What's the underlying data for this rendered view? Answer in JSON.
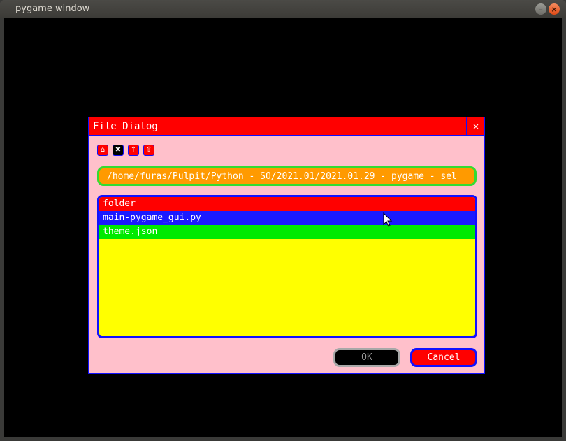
{
  "window": {
    "title": "pygame window",
    "minimize_icon": "minimize-icon",
    "close_icon": "close-icon"
  },
  "dialog": {
    "title": "File Dialog",
    "close_label": "×",
    "toolbar": [
      {
        "icon": "home-icon",
        "glyph": "⌂"
      },
      {
        "icon": "delete-icon",
        "glyph": "✖"
      },
      {
        "icon": "parent-directory-icon",
        "glyph": "↑"
      },
      {
        "icon": "refresh-icon",
        "glyph": "⇧"
      }
    ],
    "path_value": "/home/furas/Pulpit/Python - SO/2021.01/2021.01.29 - pygame - sel",
    "files": [
      {
        "name": "folder",
        "color": "#ff0000"
      },
      {
        "name": "main-pygame_gui.py",
        "color": "#1a1aff"
      },
      {
        "name": "theme.json",
        "color": "#00ea00"
      }
    ],
    "ok_label": "OK",
    "cancel_label": "Cancel"
  },
  "colors": {
    "background": "#000000",
    "dialog_bg": "#ffc0cb",
    "title_bar": "#ff0000",
    "path_bg": "#ff9a00",
    "path_border": "#32dc32",
    "list_bg": "#ffff00",
    "border": "#1010ff"
  }
}
